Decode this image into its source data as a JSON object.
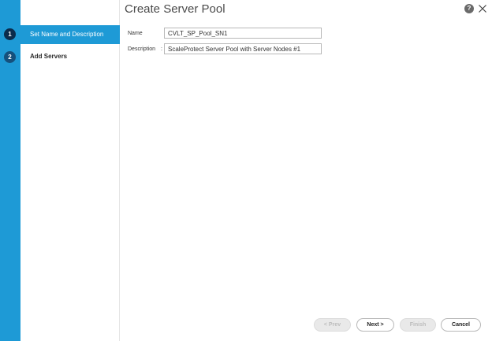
{
  "dialog": {
    "title": "Create Server Pool",
    "help_label": "?"
  },
  "steps": [
    {
      "number": "1",
      "label": "Set Name and Description",
      "active": true
    },
    {
      "number": "2",
      "label": "Add Servers",
      "active": false
    }
  ],
  "form": {
    "name": {
      "label": "Name",
      "value": "CVLT_SP_Pool_SN1"
    },
    "description": {
      "label": "Description",
      "value": "ScaleProtect Server Pool with Server Nodes #1"
    }
  },
  "footer": {
    "prev_label": "< Prev",
    "next_label": "Next >",
    "finish_label": "Finish",
    "cancel_label": "Cancel"
  },
  "colors": {
    "accent": "#1e9ad6",
    "step_badge": "#0b2c4d"
  }
}
